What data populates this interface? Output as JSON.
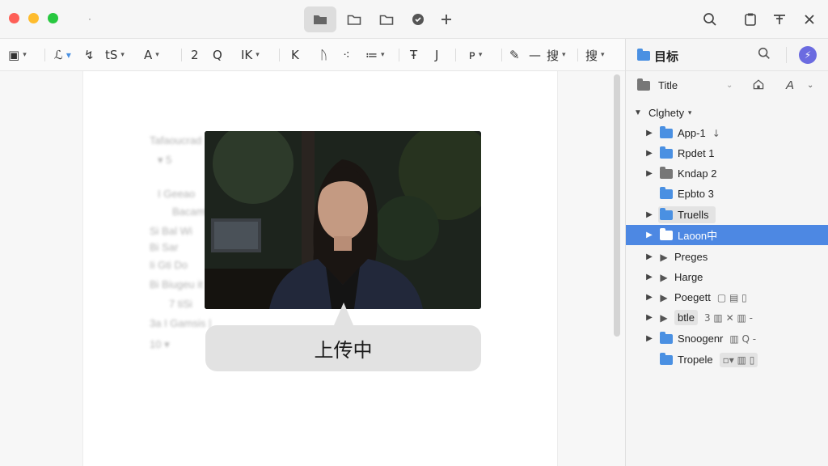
{
  "titlebar": {
    "dot": "·",
    "icons": [
      "folder-filled-icon",
      "folder-icon",
      "folder-outline-icon",
      "badge-gear-icon",
      "plus-icon"
    ],
    "right_icons": [
      "search-icon",
      "clipboard-icon",
      "translate-icon",
      "close-icon"
    ]
  },
  "toolbar": {
    "items": [
      "ℒ",
      "↯",
      "tS",
      "A",
      "2",
      "Q",
      "IK",
      "K",
      "ᚢ",
      "≔",
      "Ŧ",
      "J",
      "ᴘ",
      "✎",
      "—",
      "搜",
      "搜"
    ],
    "num": "2"
  },
  "editor": {
    "blur_lines": [
      "Tafaoucrad",
      "▾  5",
      "I  Geeao",
      "Bacamt",
      "Si  Bal  Wi",
      "Bi  Sar",
      "Ii  Gti  Do",
      "Bi  Biugeu  it",
      "7  tiSi",
      "3a  I  Gamsis  |",
      "10  ▾"
    ]
  },
  "upload": {
    "status": "上传中"
  },
  "panel": {
    "title": "目标",
    "filter_label": "Title",
    "filter_letter": "A",
    "root": "Clghety",
    "items": [
      {
        "label": "App-1",
        "suffix": "↓",
        "folder": "blue",
        "expand": true
      },
      {
        "label": "Rpdet 1",
        "suffix": "",
        "folder": "blue",
        "expand": true
      },
      {
        "label": "Kndap 2",
        "suffix": "",
        "folder": "gray",
        "expand": true
      },
      {
        "label": "Epbto 3",
        "suffix": "",
        "folder": "blue",
        "expand": false
      },
      {
        "label": "Truells",
        "suffix": "",
        "folder": "blue",
        "expand": true
      },
      {
        "label": "Laoon中",
        "suffix": "",
        "folder": "blue",
        "expand": true,
        "selected": true
      },
      {
        "label": "Preges",
        "suffix": "",
        "folder": "tri",
        "expand": true
      },
      {
        "label": "Harge",
        "suffix": "",
        "folder": "tri",
        "expand": true
      },
      {
        "label": "Poegett",
        "suffix": "▢  ▤  ▯",
        "folder": "tri",
        "expand": true
      },
      {
        "label": "btle",
        "suffix": "3  ▥  ✕  ▥  -",
        "folder": "tri",
        "expand": true
      },
      {
        "label": "Snoogenr",
        "suffix": "▥  Q  -",
        "folder": "blue",
        "expand": true
      },
      {
        "label": "Tropele",
        "suffix": "▫▾  ▥  ▯",
        "folder": "blue",
        "expand": false
      }
    ]
  },
  "colors": {
    "accent": "#4d88e3",
    "traffic_red": "#fe5f57",
    "traffic_yellow": "#febc2e",
    "traffic_green": "#28c840"
  }
}
